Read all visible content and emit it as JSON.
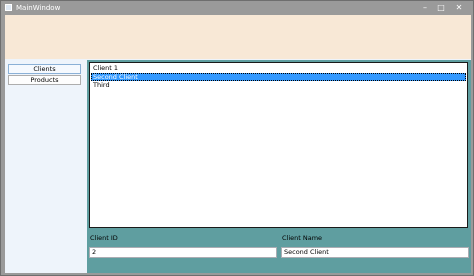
{
  "window": {
    "title": "MainWindow",
    "controls": {
      "minimize": "–",
      "maximize": "□",
      "close": "✕"
    }
  },
  "nav": {
    "items": [
      {
        "label": "Clients"
      },
      {
        "label": "Products"
      }
    ]
  },
  "clients_list": {
    "items": [
      {
        "label": "Client 1"
      },
      {
        "label": "Second Client"
      },
      {
        "label": "Third"
      }
    ],
    "selected_index": 1
  },
  "details": {
    "client_id_label": "Client ID",
    "client_id_value": "2",
    "client_name_label": "Client Name",
    "client_name_value": "Second Client"
  },
  "colors": {
    "header_band": "#f8e8d6",
    "content_background": "#5f9ea0",
    "selection": "#3399ff",
    "nav_background": "#eef4fb"
  }
}
